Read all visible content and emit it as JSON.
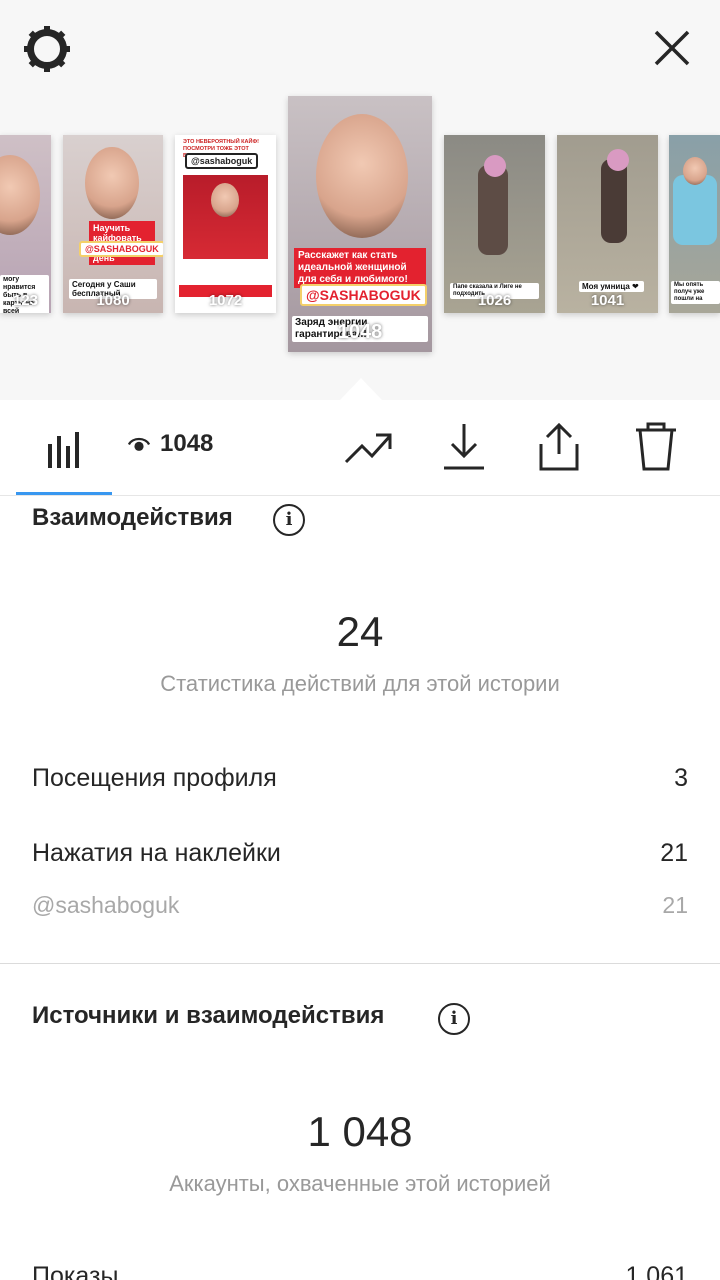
{
  "colors": {
    "accent": "#3897f0",
    "text": "#262626",
    "muted": "#999999",
    "brand_red": "#e3222f"
  },
  "header": {
    "settings_icon": "gear-icon",
    "close_icon": "close-icon"
  },
  "stories": [
    {
      "views": "123",
      "caption": "могу нравится быть в карты на всей жизни..."
    },
    {
      "views": "1080",
      "caption_red": "Научить кайфовать каждый день",
      "tag": "@SASHABOGUK",
      "caption": "Сегодня у Саши бесплатный"
    },
    {
      "views": "1072",
      "header": "ЭТО НЕВЕРОЯТНЫЙ КАЙФ! ПОСМОТРИ ТОЖЕ ЭТОТ ВЕБИНАР С",
      "tag": "@sashaboguk"
    },
    {
      "views": "1048",
      "caption_red": "Расскажет как стать идеальной женщиной для себя и любимого!",
      "tag": "@SASHABOGUK",
      "caption": "Заряд энергии гарантирован!"
    },
    {
      "views": "1026",
      "caption": "Папе сказала и Лиге не подходить"
    },
    {
      "views": "1041",
      "caption": "Моя умница ❤"
    },
    {
      "views": "",
      "caption": "Мы опять получ уже пошли на"
    }
  ],
  "toolbar": {
    "stats_icon": "bar-chart-icon",
    "views": "1048",
    "trend_icon": "trending-icon",
    "download_icon": "download-icon",
    "share_icon": "share-icon",
    "delete_icon": "trash-icon"
  },
  "interactions": {
    "title": "Взаимодействия",
    "total": "24",
    "subtitle": "Статистика действий для этой истории",
    "rows": [
      {
        "label": "Посещения профиля",
        "value": "3"
      },
      {
        "label": "Нажатия на наклейки",
        "value": "21"
      },
      {
        "label": "@sashaboguk",
        "value": "21"
      }
    ]
  },
  "sources": {
    "title": "Источники и взаимодействия",
    "total": "1 048",
    "subtitle": "Аккаунты, охваченные этой историей",
    "rows": [
      {
        "label": "Показы",
        "value": "1 061"
      }
    ]
  }
}
